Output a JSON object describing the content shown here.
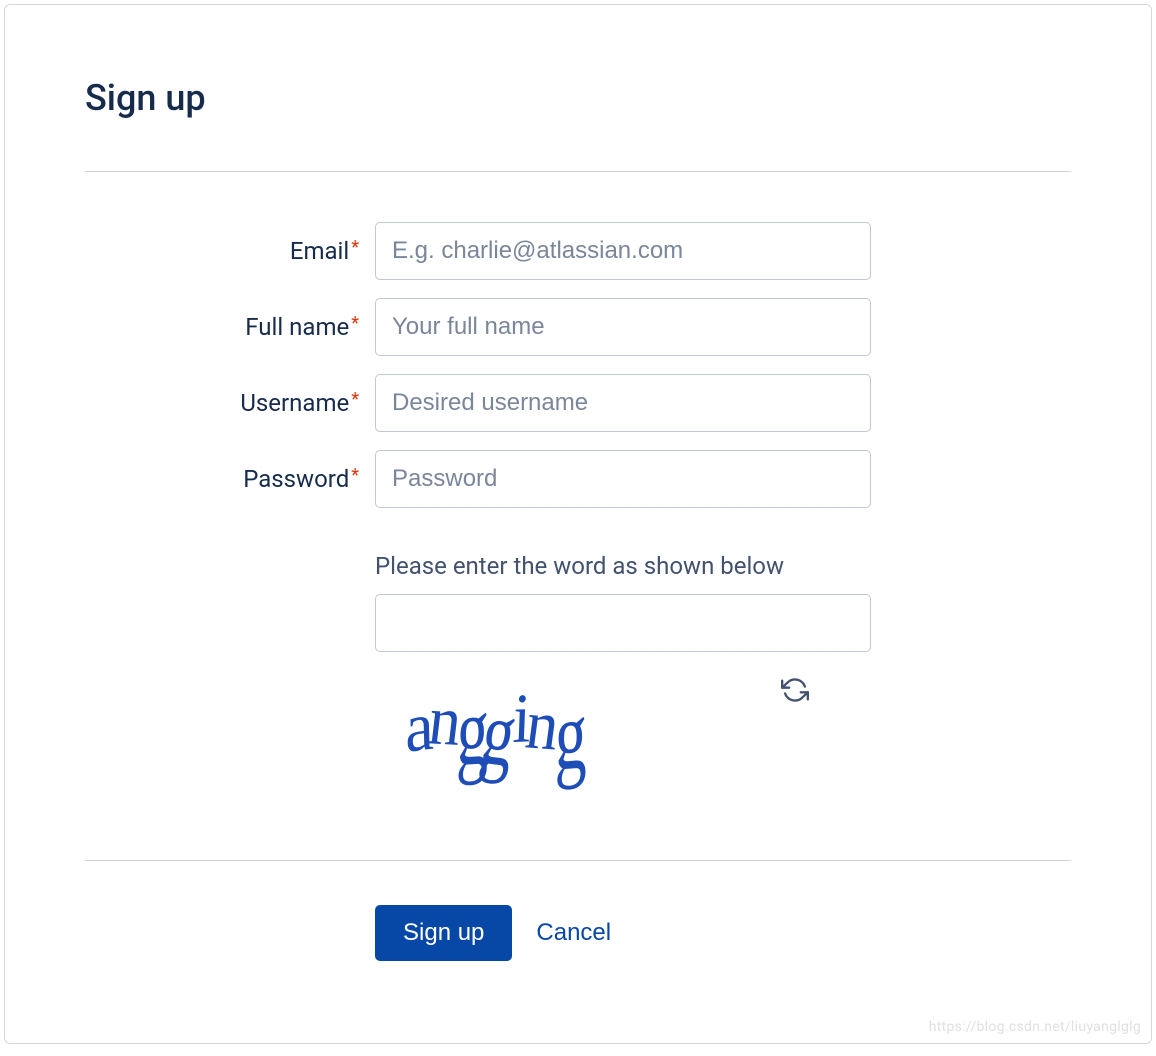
{
  "page": {
    "title": "Sign up"
  },
  "fields": {
    "email": {
      "label": "Email",
      "placeholder": "E.g. charlie@atlassian.com",
      "value": ""
    },
    "fullname": {
      "label": "Full name",
      "placeholder": "Your full name",
      "value": ""
    },
    "username": {
      "label": "Username",
      "placeholder": "Desired username",
      "value": ""
    },
    "password": {
      "label": "Password",
      "placeholder": "Password",
      "value": ""
    }
  },
  "captcha": {
    "prompt": "Please enter the word as shown below",
    "text": "angging",
    "value": ""
  },
  "actions": {
    "submit": "Sign up",
    "cancel": "Cancel"
  },
  "watermark": "https://blog.csdn.net/liuyanglglg"
}
